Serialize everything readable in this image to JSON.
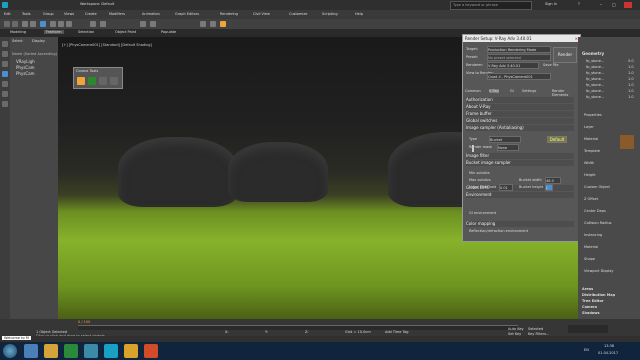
{
  "title_bar": {
    "title": "Workspace: Default",
    "search_placeholder": "Type a keyword or phrase",
    "user": "Sign In",
    "help": "?"
  },
  "menu": {
    "items": [
      "Edit",
      "Tools",
      "Group",
      "Views",
      "Create",
      "Modifiers",
      "Animation",
      "Graph Editors",
      "Rendering",
      "Civil View",
      "Customize",
      "Scripting",
      "Help"
    ]
  },
  "ribbon": {
    "tabs": [
      "Modeling",
      "Freeform",
      "Selection",
      "Object Paint",
      "Populate"
    ]
  },
  "scene_explorer": {
    "header": [
      "Select",
      "Display"
    ],
    "column": "Name (Sorted Ascending)",
    "items": [
      "VRayLigh",
      "PhysCam",
      "PhysCam"
    ]
  },
  "viewport": {
    "label": "[+] [PhysCamera001] [Standard] [Default Shading]"
  },
  "vfb_tools": {
    "title": "Corona Tools",
    "label": "Cor..."
  },
  "render_setup": {
    "title": "Render Setup: V-Ray Adv 3.40.01",
    "target_label": "Target:",
    "target_value": "Production Rendering Mode",
    "preset_label": "Preset:",
    "preset_value": "No preset selected",
    "renderer_label": "Renderer:",
    "renderer_value": "V-Ray Adv 3.40.01",
    "view_label": "View to Render:",
    "view_value": "Quad 4 - PhysCamera001",
    "save_file_label": "Save File",
    "render_button": "Render",
    "tabs": [
      "Common",
      "V-Ray",
      "GI",
      "Settings",
      "Render Elements"
    ],
    "rollouts": [
      "Authorization",
      "About V-Ray",
      "Frame buffer",
      "Global switches",
      "Image sampler (Antialiasing)",
      "Image filter",
      "Bucket image sampler",
      "Global DMC",
      "Environment",
      "Color mapping"
    ],
    "sampler_type_label": "Type",
    "sampler_type_value": "Bucket",
    "render_mask_label": "Render mask",
    "render_mask_value": "None",
    "min_subdivs_label": "Min subdivs",
    "max_subdivs_label": "Max subdivs",
    "noise_label": "Noise threshold",
    "noise_value": "0.01",
    "bucket_width_label": "Bucket width",
    "bucket_width_value": "48.0",
    "bucket_height_label": "Bucket height",
    "bucket_height_value": "L",
    "gi_env_label": "GI environment",
    "reflection_label": "Reflection/refraction environment",
    "default_btn": "Default"
  },
  "command_panel": {
    "section": "Geometry",
    "items": [
      "fp_stone...",
      "fp_stone...",
      "fp_stone...",
      "fp_stone...",
      "fp_stone...",
      "fp_stone...",
      "fp_stone..."
    ],
    "values": [
      "5.0",
      "1.0",
      "1.0",
      "1.0",
      "1.0",
      "1.0",
      "1.0"
    ],
    "props": [
      "Properties",
      "Layer",
      "Material",
      "Template",
      "Width",
      "Height",
      "Custom Object",
      "Z Offset",
      "Center Deps",
      "Collision Radius",
      "Instancing",
      "Material",
      "Shape",
      "Viewport Display"
    ],
    "rollouts": [
      "Areas",
      "Distribution Map",
      "Tree Editor",
      "Camera",
      "Shadows"
    ]
  },
  "status": {
    "selected": "1 Object Selected",
    "hint": "Click or click-and-drag to select objects",
    "welcome": "Welcome to M",
    "frame": "0 / 100",
    "x_label": "X:",
    "y_label": "Y:",
    "z_label": "Z:",
    "grid": "Grid = 10.0cm",
    "time_tag": "Add Time Tag",
    "auto_key": "Auto Key",
    "set_key": "Set Key",
    "selected_mode": "Selected",
    "key_filters": "Key Filters..."
  },
  "taskbar": {
    "time": "13:38",
    "date": "01.04.2017",
    "lang": "EN"
  },
  "colors": {
    "accent": "#f2a33a",
    "viewport_bg": "#1b1b1b",
    "grass": "#86b22b"
  }
}
